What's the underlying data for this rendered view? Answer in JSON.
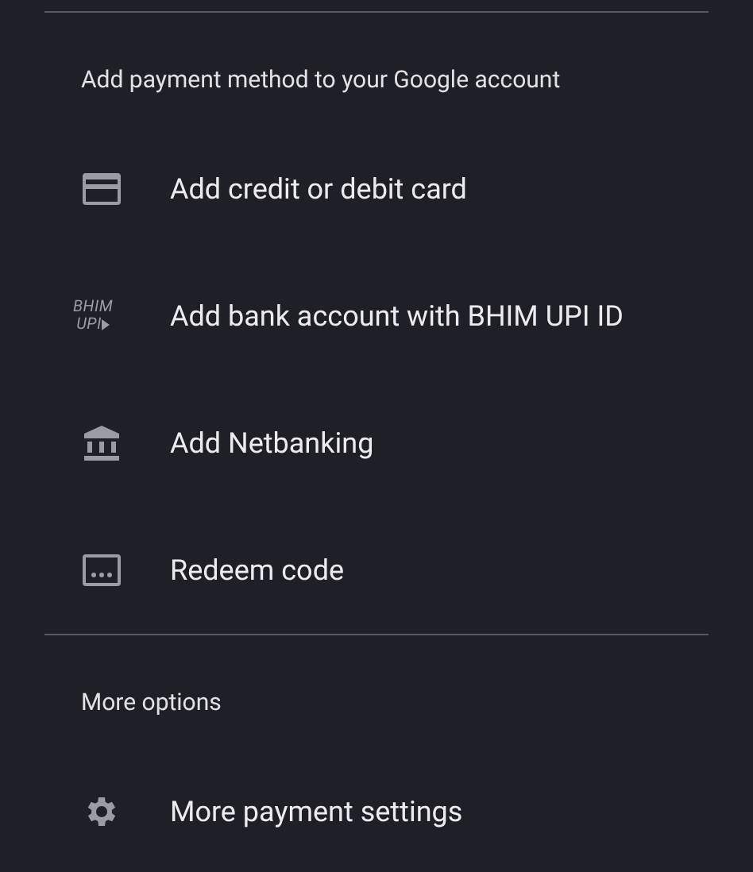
{
  "sections": [
    {
      "heading": "Add payment method to your Google account",
      "items": [
        {
          "kind": "card",
          "label": "Add credit or debit card"
        },
        {
          "kind": "upi",
          "label": "Add bank account with BHIM UPI ID",
          "logo_lines": [
            "BHIM",
            "UPI"
          ]
        },
        {
          "kind": "bank",
          "label": "Add Netbanking"
        },
        {
          "kind": "redeem",
          "label": "Redeem code"
        }
      ]
    },
    {
      "heading": "More options",
      "items": [
        {
          "kind": "settings",
          "label": "More payment settings"
        }
      ]
    }
  ]
}
